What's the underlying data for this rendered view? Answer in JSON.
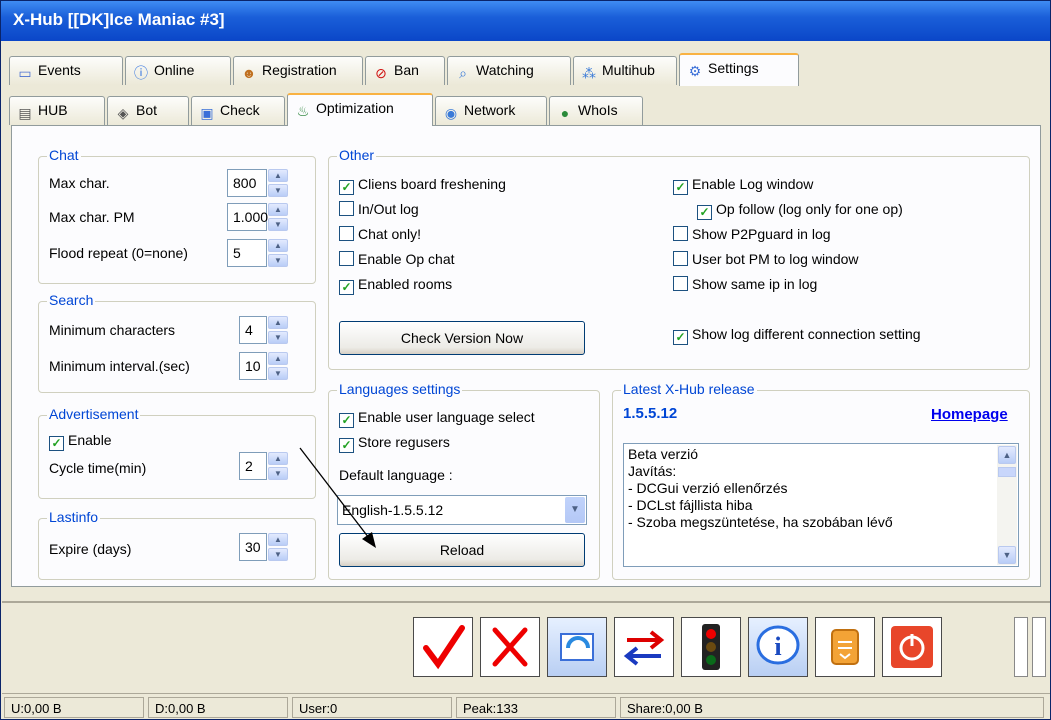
{
  "window": {
    "title": "X-Hub [[DK]Ice Maniac #3]"
  },
  "main_tabs": [
    {
      "label": "Events",
      "icon": "events-icon"
    },
    {
      "label": "Online",
      "icon": "info-icon"
    },
    {
      "label": "Registration",
      "icon": "users-icon"
    },
    {
      "label": "Ban",
      "icon": "ban-icon"
    },
    {
      "label": "Watching",
      "icon": "magnifier-icon"
    },
    {
      "label": "Multihub",
      "icon": "multihub-icon"
    },
    {
      "label": "Settings",
      "icon": "settings-icon",
      "active": true
    }
  ],
  "sub_tabs": [
    {
      "label": "HUB",
      "icon": "hub-icon"
    },
    {
      "label": "Bot",
      "icon": "bot-icon"
    },
    {
      "label": "Check",
      "icon": "check-icon"
    },
    {
      "label": "Optimization",
      "icon": "optimization-icon",
      "active": true
    },
    {
      "label": "Network",
      "icon": "network-icon"
    },
    {
      "label": "WhoIs",
      "icon": "globe-icon"
    }
  ],
  "chat": {
    "title": "Chat",
    "max_char_label": "Max char.",
    "max_char": "800",
    "max_char_pm_label": "Max char. PM",
    "max_char_pm": "1.000",
    "flood_label": "Flood repeat (0=none)",
    "flood": "5"
  },
  "search": {
    "title": "Search",
    "min_chars_label": "Minimum characters",
    "min_chars": "4",
    "min_interval_label": "Minimum interval.(sec)",
    "min_interval": "10"
  },
  "advertisement": {
    "title": "Advertisement",
    "enable_label": "Enable",
    "enable_checked": true,
    "cycle_label": "Cycle time(min)",
    "cycle": "2"
  },
  "lastinfo": {
    "title": "Lastinfo",
    "expire_label": "Expire (days)",
    "expire": "30"
  },
  "other": {
    "title": "Other",
    "left": [
      {
        "label": "Cliens board freshening",
        "checked": true
      },
      {
        "label": "In/Out log",
        "checked": false
      },
      {
        "label": "Chat only!",
        "checked": false
      },
      {
        "label": "Enable Op chat",
        "checked": false
      },
      {
        "label": "Enabled rooms",
        "checked": true
      }
    ],
    "right": [
      {
        "label": "Enable Log window",
        "checked": true
      },
      {
        "label": "Op follow (log only for one op)",
        "checked": true
      },
      {
        "label": "Show P2Pguard in log",
        "checked": false
      },
      {
        "label": "User bot PM to log window",
        "checked": false
      },
      {
        "label": "Show same ip in log",
        "checked": false
      },
      {
        "label": "Show log different connection setting",
        "checked": true
      }
    ],
    "check_version_label": "Check Version Now"
  },
  "languages": {
    "title": "Languages settings",
    "enable_select_label": "Enable user language select",
    "enable_select_checked": true,
    "store_regusers_label": "Store regusers",
    "store_regusers_checked": true,
    "default_label": "Default language :",
    "default_value": "English-1.5.5.12",
    "reload_label": "Reload"
  },
  "release": {
    "title": "Latest X-Hub release",
    "version": "1.5.5.12",
    "homepage_label": "Homepage",
    "notes": [
      "Beta verzió",
      "Javítás:",
      "- DCGui verzió ellenőrzés",
      "- DCLst fájllista hiba",
      "- Szoba megszüntetése, ha szobában lévő"
    ]
  },
  "toolbar": [
    "apply-check-icon",
    "cancel-x-icon",
    "refresh-icon",
    "swap-arrows-icon",
    "traffic-light-icon",
    "info-icon",
    "notes-icon",
    "power-icon"
  ],
  "status": {
    "upload": "U:0,00 B",
    "download": "D:0,00 B",
    "users": "User:0",
    "peak": "Peak:133",
    "share": "Share:0,00 B"
  },
  "colors": {
    "title_bar": "#0a46c8",
    "group_label": "#0046d5",
    "link": "#0000ee",
    "version": "#0046d5",
    "check": "#21a121"
  }
}
